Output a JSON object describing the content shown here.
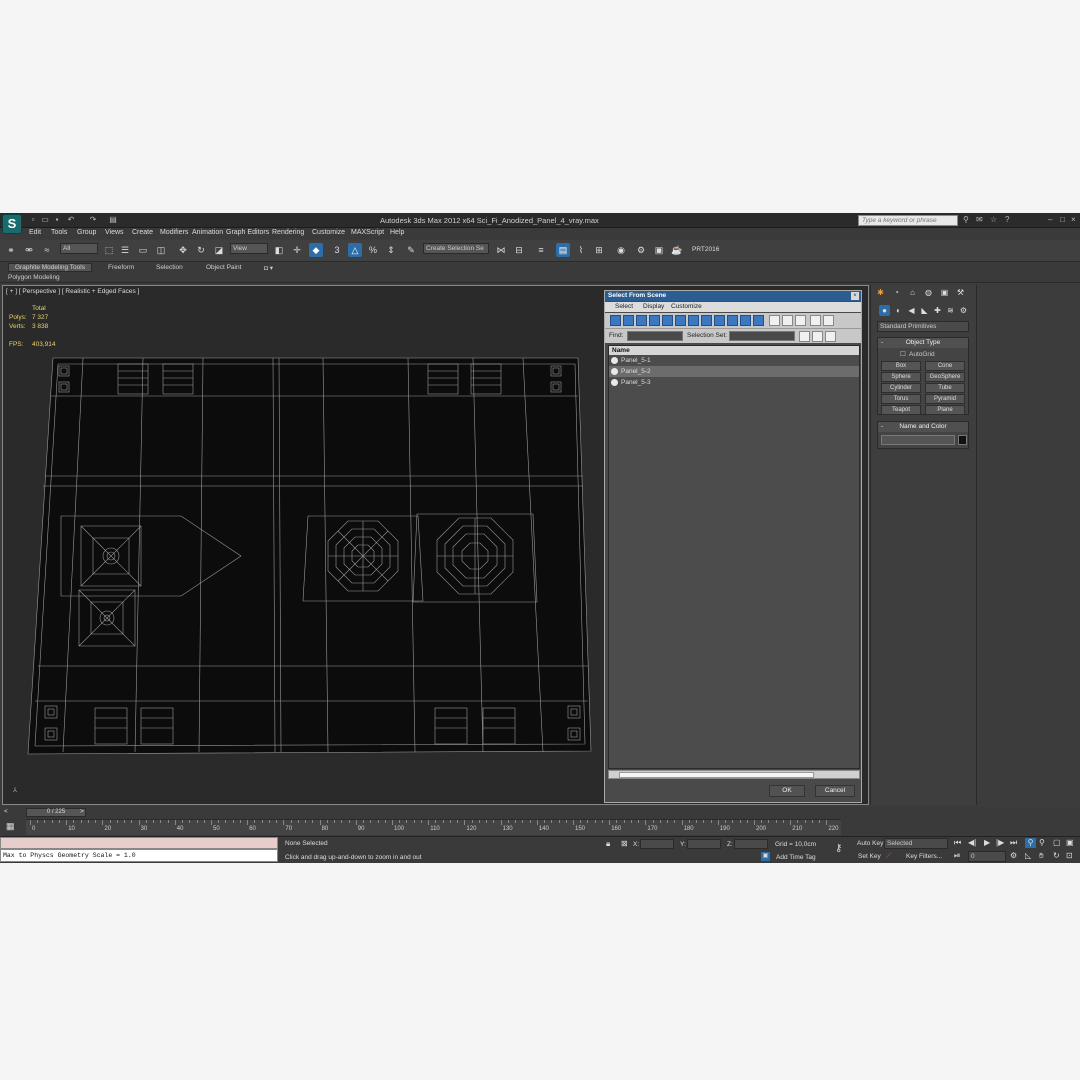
{
  "app": {
    "title": "Autodesk 3ds Max  2012 x64     Sci_Fi_Anodized_Panel_4_vray.max",
    "logo": "3ds-max-logo",
    "search_placeholder": "Type a keyword or phrase"
  },
  "menu": [
    "Edit",
    "Tools",
    "Group",
    "Views",
    "Create",
    "Modifiers",
    "Animation",
    "Graph Editors",
    "Rendering",
    "Customize",
    "MAXScript",
    "Help"
  ],
  "toolbar": {
    "filter": "All",
    "ref_coord": "View",
    "selection_set": "Create Selection Se",
    "prt_label": "PRT2016",
    "snap_label": "3"
  },
  "ribbon": {
    "tabs": [
      "Graphite Modeling Tools",
      "Freeform",
      "Selection",
      "Object Paint"
    ],
    "sub": "Polygon Modeling"
  },
  "viewport": {
    "label": "[ + ] [ Perspective ] [ Realistic + Edged Faces ]",
    "stats": {
      "total_label": "Total",
      "polys_label": "Polys:",
      "polys": "7 327",
      "verts_label": "Verts:",
      "verts": "3 838",
      "fps_label": "FPS:",
      "fps": "403,914"
    }
  },
  "dialog": {
    "title": "Select From Scene",
    "menu": [
      "Select",
      "Display",
      "Customize"
    ],
    "find_label": "Find:",
    "selection_set_label": "Selection Set:",
    "column_name": "Name",
    "items": [
      "Panel_5-1",
      "Panel_5-2",
      "Panel_5-3"
    ],
    "ok": "OK",
    "cancel": "Cancel"
  },
  "command_panel": {
    "category": "Standard Primitives",
    "object_type_title": "Object Type",
    "autogrid": "AutoGrid",
    "buttons": [
      "Box",
      "Cone",
      "Sphere",
      "GeoSphere",
      "Cylinder",
      "Tube",
      "Torus",
      "Pyramid",
      "Teapot",
      "Plane"
    ],
    "name_color_title": "Name and Color"
  },
  "timeline": {
    "slider": "0 / 225",
    "ticks": [
      "0",
      "10",
      "20",
      "30",
      "40",
      "50",
      "60",
      "70",
      "80",
      "90",
      "100",
      "110",
      "120",
      "130",
      "140",
      "150",
      "160",
      "170",
      "180",
      "190",
      "200",
      "210",
      "220"
    ]
  },
  "status": {
    "listener": "Max to Physcs Geometry Scale = 1.0",
    "selection": "None Selected",
    "prompt": "Click and drag up-and-down to zoom in and out",
    "x_label": "X:",
    "y_label": "Y:",
    "z_label": "Z:",
    "grid": "Grid = 10,0cm",
    "add_time_tag": "Add Time Tag",
    "auto_key": "Auto Key",
    "set_key": "Set Key",
    "key_mode": "Selected",
    "key_filters": "Key Filters...",
    "frame": "0"
  }
}
